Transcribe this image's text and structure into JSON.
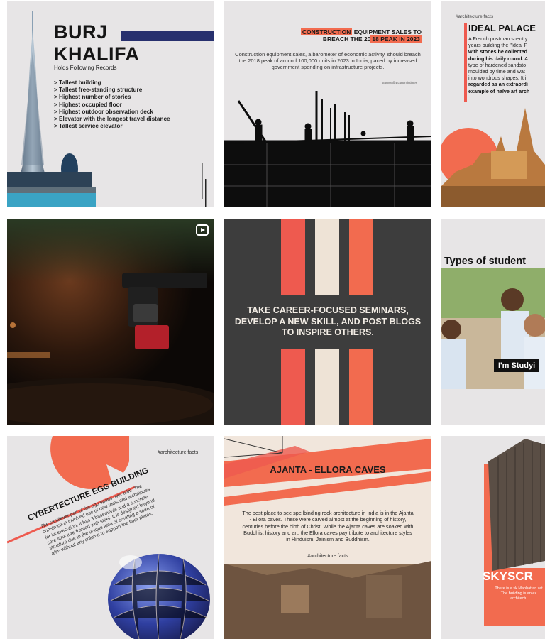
{
  "tiles": {
    "burj": {
      "title_line1": "BURJ",
      "title_line2": "KHALIFA",
      "subtitle": "Holds Following Records",
      "records": [
        "> Tallest building",
        "> Tallest free-standing structure",
        "> Highest number of stories",
        "> Highest occupied floor",
        "> Highest outdoor observation deck",
        "> Elevator with the longest travel distance",
        "> Tallest service elevator"
      ]
    },
    "construction": {
      "heading_hl1": "CONSTRUCTION",
      "heading_part1": " EQUIPMENT SALES TO",
      "heading_part2": "BREACH THE 20",
      "heading_hl2": "18 PEAK IN 2023",
      "body": "Construction equipment sales, a barometer of economic activity, should breach the 2018 peak of around 100,000 units in 2023 in India, paced by increased government spending on infrastructure projects.",
      "source": "Source@Economictimes"
    },
    "ideal_palace": {
      "tag": "#architecture facts",
      "title": "IDEAL PALACE",
      "body_1": "A French postman spent y",
      "body_2": "years building the \"Ideal P",
      "body_3": "with stones he collected",
      "body_4": "during his daily round.",
      "body_5": " A",
      "body_6": "type of hardened sandsto",
      "body_7": "moulded by time and wat",
      "body_8": "into wondrous shapes. It i",
      "body_9": "regarded as an extraordi",
      "body_10": "example of naïve art arch"
    },
    "turntable": {
      "badge_icon": "reel-icon"
    },
    "career": {
      "text": "TAKE CAREER-FOCUSED SEMINARS, DEVELOP A NEW SKILL, AND POST BLOGS TO INSPIRE OTHERS."
    },
    "students": {
      "title": "Types of student",
      "caption": "I'm Studyi"
    },
    "cybertecture": {
      "tag": "#architecture facts",
      "title": "CYBERTECTURE EGG BUILDING",
      "body": "The cantilever part of the egg spans over a/lm. The construction involved use of new tools and techniques for its execution. It has 3 basements and a concrete core structure framed with steel. It is designed beyond structure due to the unique idea of creating a span of a/lm without any column to support the floor plates."
    },
    "ajanta": {
      "title": "AJANTA - ELLORA CAVES",
      "body": "The best place to see spellbinding rock architecture in India is in the Ajanta - Ellora caves. These were carved almost at the beginning of history, centuries before the birth of Christ. While the Ajanta caves are soaked with Buddhist history and art, the Ellora caves pay tribute to architecture styles in Hinduism, Jainism and Buddhism.",
      "tag": "#architecture facts"
    },
    "skyscraper": {
      "title": "SKYSCR",
      "body": "There is a sk Manhattan wit The building is an ex architectu"
    }
  },
  "colors": {
    "coral": "#f26b4f",
    "salmon": "#ee5a4f",
    "cream": "#eee3d6",
    "dark": "#3a3a3a",
    "navy": "#27306e",
    "tile_bg": "#e7e5e6"
  }
}
